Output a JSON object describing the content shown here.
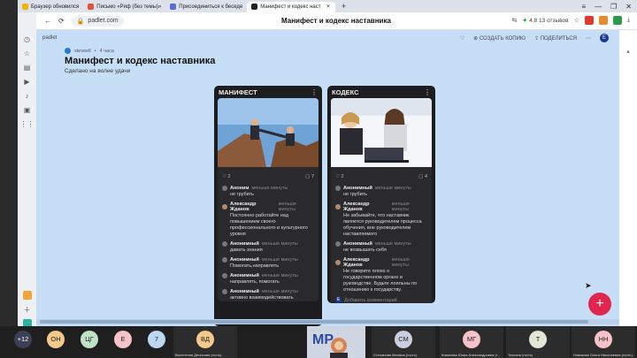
{
  "browser": {
    "tabs": [
      {
        "label": "Браузер обновился",
        "color": "#f0b400"
      },
      {
        "label": "Письмо «Риф (без темы)»",
        "color": "#e2533b"
      },
      {
        "label": "Присоединиться к беседе",
        "color": "#5b6bd6"
      },
      {
        "label": "Манифест и кодекс наст",
        "color": "#222222"
      }
    ],
    "url": "padlet.com",
    "page_title": "Манифест и кодекс наставника",
    "reviews": "4.8  13 отзывов"
  },
  "padlet": {
    "brand": "padlet",
    "author": "steveell",
    "age": "4 часа",
    "title": "Манифест и кодекс наставника",
    "subtitle": "Сделано на волне удачи",
    "actions": {
      "create_copy": "СОЗДАТЬ КОПИЮ",
      "share": "ПОДЕЛИТЬСЯ",
      "avatar_letter": "E"
    },
    "columns": [
      {
        "title": "МАНИФЕСТ",
        "likes": "2",
        "comments": "7",
        "items": [
          {
            "author": "Аноним",
            "time": "меньше минуты",
            "text": "не грубить"
          },
          {
            "author": "Александр Жданов",
            "time": "меньше минуты",
            "text": "Постоянно работайте над повышением своего профессионального и культурного уровня"
          },
          {
            "author": "Анонимный",
            "time": "меньше минуты",
            "text": "давать знания"
          },
          {
            "author": "Анонимный",
            "time": "меньше минуты",
            "text": "Помогать,направлять"
          },
          {
            "author": "Анонимный",
            "time": "меньше минуты",
            "text": "направлять, помогать"
          },
          {
            "author": "Анонимный",
            "time": "меньше минуты",
            "text": "активно взаимодействовать"
          }
        ]
      },
      {
        "title": "КОДЕКС",
        "likes": "2",
        "comments": "4",
        "items": [
          {
            "author": "Анонимный",
            "time": "меньше минуты",
            "text": "не грубить"
          },
          {
            "author": "Александр Жданов",
            "time": "меньше минуты",
            "text": "Не забывайте, что наставник является руководителем процесса обучения, вне руководителем наставляемого"
          },
          {
            "author": "Анонимный",
            "time": "меньше минуты",
            "text": "не возвышать себя"
          },
          {
            "author": "Александр Жданов",
            "time": "меньше минуты",
            "text": "Не говорите плохо о государственном органе и руководстве. Будьте лояльны по отношению к государству."
          }
        ],
        "add_comment": "Добавить комментарий"
      }
    ],
    "fab": "+"
  },
  "participants": {
    "more": "+12",
    "circles": [
      {
        "initials": "ОН",
        "color": "#f3c98c"
      },
      {
        "initials": "ЦГ",
        "color": "#bfe3c6"
      },
      {
        "initials": "Е",
        "color": "#f7c2c8"
      },
      {
        "initials": "7",
        "color": "#bcd7f2"
      }
    ],
    "tiles": [
      {
        "initials": "ВД",
        "name": "Валентина Денисова (гость)",
        "color": "#f3c98c"
      },
      {
        "initials": "СМ",
        "name": "Степанова Милана (гость)",
        "color": "#c9cfe0"
      },
      {
        "initials": "МГ",
        "name": "Ковалева Юлия Александровна (г...",
        "color": "#f7c2c8"
      },
      {
        "initials": "Т",
        "name": "Татьяна (гость)",
        "color": "#e4e4d7"
      },
      {
        "initials": "НН",
        "name": "Новикова Ольга Николаевна (гость)",
        "color": "#f7c2c8"
      }
    ],
    "video_label": "МР"
  },
  "colors": {
    "page_bg": "#c6dff7",
    "fab": "#e0264f",
    "column_bg": "#1d1d1f"
  }
}
